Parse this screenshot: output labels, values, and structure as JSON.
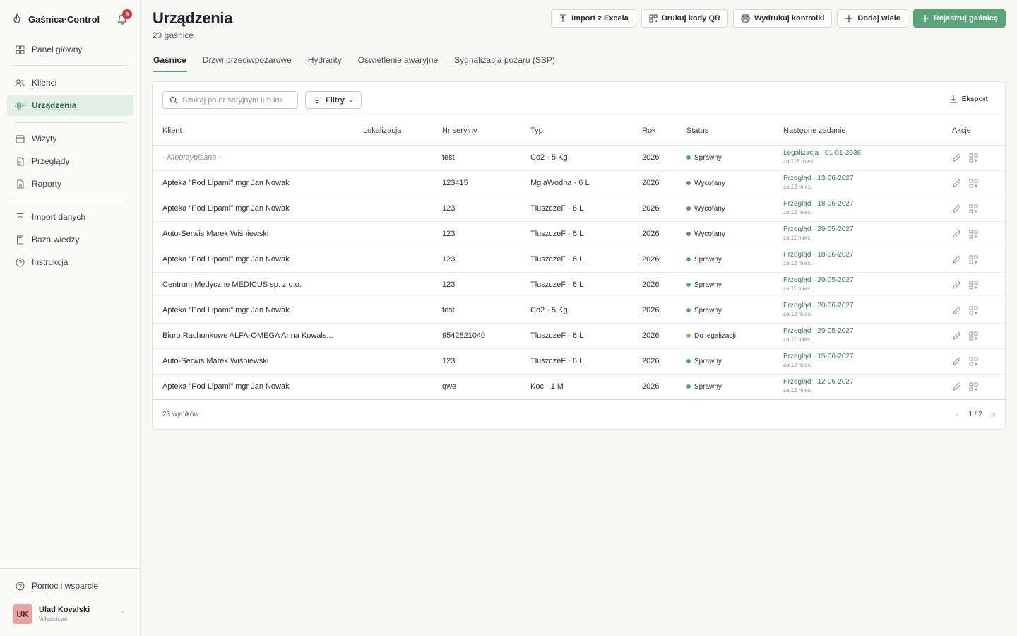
{
  "app": {
    "name": "Gaśnica·Control",
    "notifications": "6"
  },
  "sidebar": {
    "items": [
      {
        "label": "Panel główny",
        "icon": "grid-icon"
      },
      {
        "label": "Klienci",
        "icon": "users-icon"
      },
      {
        "label": "Urządzenia",
        "icon": "devices-icon",
        "active": true
      },
      {
        "label": "Wizyty",
        "icon": "calendar-icon"
      },
      {
        "label": "Przeglądy",
        "icon": "inspection-icon"
      },
      {
        "label": "Raporty",
        "icon": "report-icon"
      },
      {
        "label": "Import danych",
        "icon": "upload-icon"
      },
      {
        "label": "Baza wiedzy",
        "icon": "book-icon"
      },
      {
        "label": "Instrukcja",
        "icon": "help-icon"
      }
    ],
    "help": "Pomoc i wsparcie",
    "user": {
      "initials": "UK",
      "name": "Ulad Kovalski",
      "role": "Właściciel"
    }
  },
  "header": {
    "title": "Urządzenia",
    "subtitle": "23 gaśnice",
    "buttons": {
      "import": "Import z Excela",
      "qr": "Drukuj kody QR",
      "print": "Wydrukuj kontrolki",
      "add_many": "Dodaj wiele",
      "register": "Rejestruj gaśnicę"
    }
  },
  "tabs": [
    "Gaśnice",
    "Drzwi przeciwpożarowe",
    "Hydranty",
    "Oświetlenie awaryjne",
    "Sygnalizacja pożaru (SSP)"
  ],
  "toolbar": {
    "search_placeholder": "Szukaj po nr seryjnym lub lok",
    "filters": "Filtry",
    "export": "Eksport"
  },
  "table": {
    "columns": [
      "Klient",
      "Lokalizacja",
      "Nr seryjny",
      "Typ",
      "Rok",
      "Status",
      "Następne zadanie",
      "Akcje"
    ],
    "rows": [
      {
        "client": "- Nieprzypisana -",
        "location": "",
        "serial": "test",
        "type": "Co2 · 5 Kg",
        "year": "2026",
        "status": "Sprawny",
        "status_color": "#4caf72",
        "task": "Legalizacja · 01-01-2036",
        "task_sub": "za 116 mies."
      },
      {
        "client": "Apteka \"Pod Lipami\" mgr Jan Nowak",
        "location": "",
        "serial": "123415",
        "type": "MglaWodna · 6 L",
        "year": "2026",
        "status": "Wycofany",
        "status_color": "#7d7f82",
        "task": "Przegląd · 13-06-2027",
        "task_sub": "za 12 mies."
      },
      {
        "client": "Apteka \"Pod Lipami\" mgr Jan Nowak",
        "location": "",
        "serial": "123",
        "type": "TluszczeF · 6 L",
        "year": "2026",
        "status": "Wycofany",
        "status_color": "#7d7f82",
        "task": "Przegląd · 18-06-2027",
        "task_sub": "za 12 mies."
      },
      {
        "client": "Auto-Serwis Marek Wiśniewski",
        "location": "",
        "serial": "123",
        "type": "TluszczeF · 6 L",
        "year": "2026",
        "status": "Wycofany",
        "status_color": "#7d7f82",
        "task": "Przegląd · 29-05-2027",
        "task_sub": "za 11 mies."
      },
      {
        "client": "Apteka \"Pod Lipami\" mgr Jan Nowak",
        "location": "",
        "serial": "123",
        "type": "TluszczeF · 6 L",
        "year": "2026",
        "status": "Sprawny",
        "status_color": "#4caf72",
        "task": "Przegląd · 18-06-2027",
        "task_sub": "za 12 mies."
      },
      {
        "client": "Centrum Medyczne MEDICUS sp. z o.o.",
        "location": "",
        "serial": "123",
        "type": "TluszczeF · 6 L",
        "year": "2026",
        "status": "Sprawny",
        "status_color": "#4caf72",
        "task": "Przegląd · 29-05-2027",
        "task_sub": "za 11 mies."
      },
      {
        "client": "Apteka \"Pod Lipami\" mgr Jan Nowak",
        "location": "",
        "serial": "test",
        "type": "Co2 · 5 Kg",
        "year": "2026",
        "status": "Sprawny",
        "status_color": "#4caf72",
        "task": "Przegląd · 20-06-2027",
        "task_sub": "za 12 mies."
      },
      {
        "client": "Biuro Rachunkowe ALFA-OMEGA Anna Kowals...",
        "location": "",
        "serial": "9542821040",
        "type": "TluszczeF · 6 L",
        "year": "2026",
        "status": "Do legalizacji",
        "status_color": "#c8a23a",
        "task": "Przegląd · 29-05-2027",
        "task_sub": "za 11 mies."
      },
      {
        "client": "Auto-Serwis Marek Wiśniewski",
        "location": "",
        "serial": "123",
        "type": "TluszczeF · 6 L",
        "year": "2026",
        "status": "Sprawny",
        "status_color": "#4caf72",
        "task": "Przegląd · 15-06-2027",
        "task_sub": "za 12 mies."
      },
      {
        "client": "Apteka \"Pod Lipami\" mgr Jan Nowak",
        "location": "",
        "serial": "qwe",
        "type": "Koc · 1 M",
        "year": "2026",
        "status": "Sprawny",
        "status_color": "#4caf72",
        "task": "Przegląd · 12-06-2027",
        "task_sub": "za 12 mies."
      }
    ]
  },
  "footer": {
    "results": "23 wyników",
    "page": "1 / 2"
  },
  "colors": {
    "accent": "#5aa47b",
    "active_bg": "#e2efe6",
    "badge": "#d23a3a"
  }
}
